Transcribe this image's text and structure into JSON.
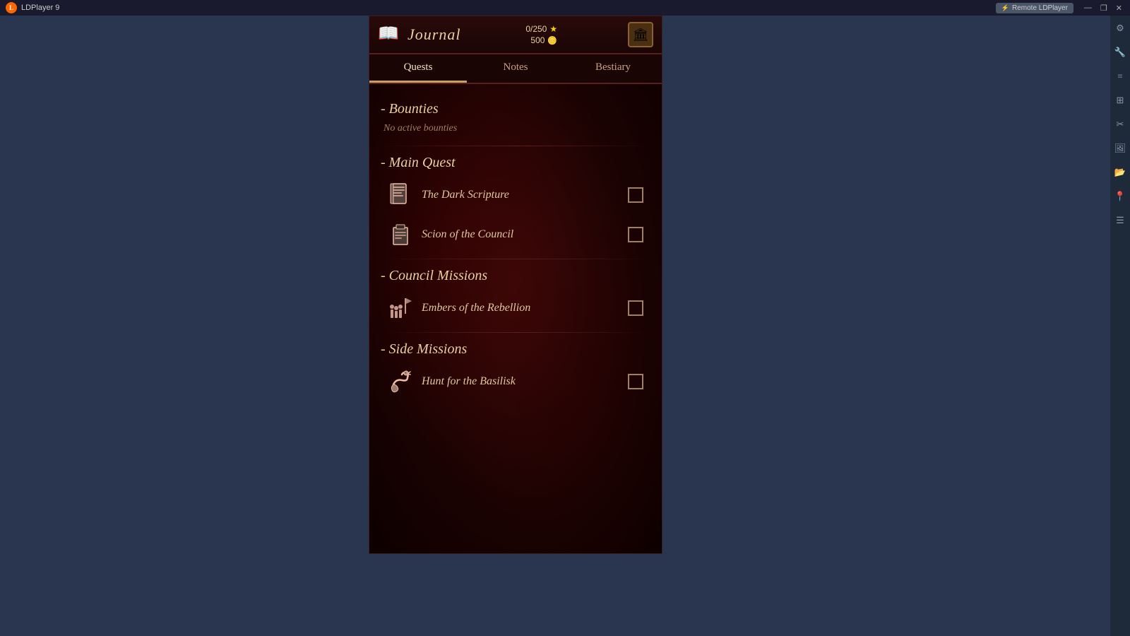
{
  "topbar": {
    "app_name": "LDPlayer 9",
    "remote_btn": "Remote LDPlayer",
    "win_minimize": "—",
    "win_restore": "❐",
    "win_close": "✕"
  },
  "journal": {
    "title": "Journal",
    "stats": {
      "progress": "0/250",
      "currency": "500"
    },
    "tabs": [
      {
        "label": "Quests",
        "active": true
      },
      {
        "label": "Notes",
        "active": false
      },
      {
        "label": "Bestiary",
        "active": false
      }
    ],
    "sections": [
      {
        "name": "Bounties",
        "empty_text": "No active bounties",
        "quests": []
      },
      {
        "name": "Main Quest",
        "quests": [
          {
            "name": "The Dark Scripture",
            "icon": "📜",
            "checked": false
          },
          {
            "name": "Scion of the Council",
            "icon": "🏛",
            "checked": false
          }
        ]
      },
      {
        "name": "Council Missions",
        "quests": [
          {
            "name": "Embers of the Rebellion",
            "icon": "⚔",
            "checked": false
          }
        ]
      },
      {
        "name": "Side Missions",
        "quests": [
          {
            "name": "Hunt for the Basilisk",
            "icon": "🐍",
            "checked": false
          }
        ]
      }
    ]
  },
  "sidebar_icons": [
    "⚙",
    "🔧",
    "📋",
    "✂",
    "🖼",
    "📂",
    "📍",
    "☰"
  ]
}
